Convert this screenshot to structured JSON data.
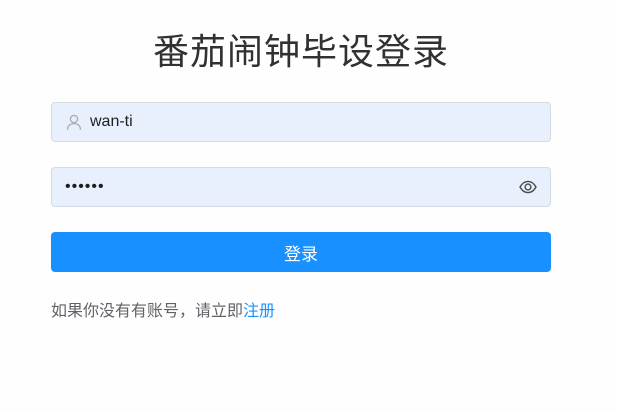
{
  "page": {
    "title": "番茄闹钟毕设登录"
  },
  "login_form": {
    "username_value": "wan-ti",
    "password_value": "••••••",
    "submit_label": "登录"
  },
  "register": {
    "prompt": "如果你没有有账号，请立即",
    "link_label": "注册"
  },
  "icons": {
    "username": "user-icon",
    "password_toggle": "eye-icon"
  },
  "colors": {
    "accent": "#1890ff",
    "input_bg": "#e8f0fe",
    "title_text": "#303133",
    "muted_text": "#606266"
  }
}
